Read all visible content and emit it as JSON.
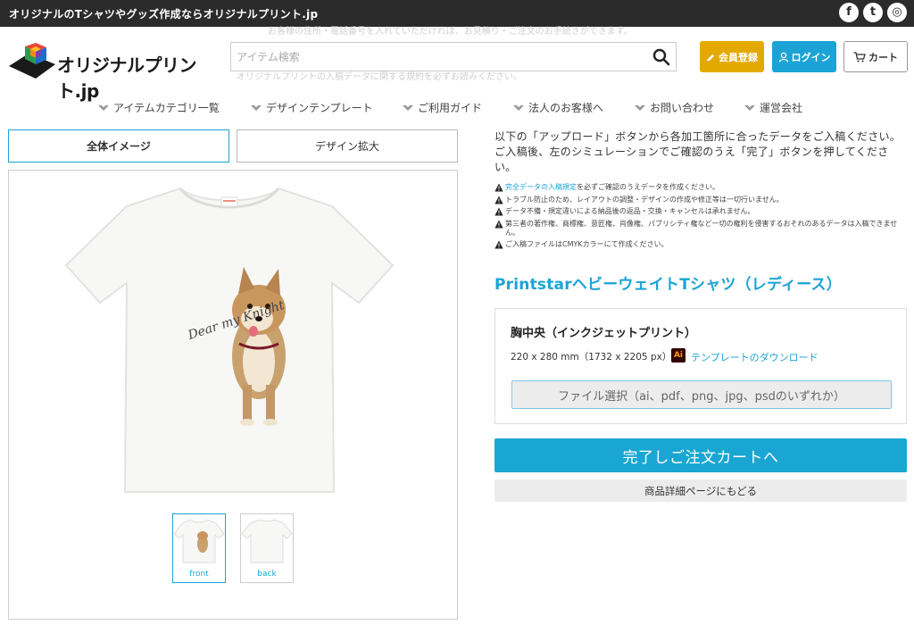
{
  "topbar": {
    "tagline": "オリジナルのTシャツやグッズ作成ならオリジナルプリント.jp",
    "social": [
      {
        "icon": "facebook-icon",
        "glyph": "f"
      },
      {
        "icon": "twitter-icon",
        "glyph": "t"
      },
      {
        "icon": "instagram-icon",
        "glyph": "◎"
      }
    ]
  },
  "header": {
    "logo_text": "オリジナルプリント.jp",
    "search_placeholder": "アイテム検索",
    "member_label": "会員登録",
    "login_label": "ログイン",
    "cart_label": "カート",
    "faded_text_1": "お客様の住所・電話番号を入れていただければ、お見積り・ご注文のお手続きができます。",
    "faded_text_2": "オリジナルプリントの入稿データに関する規約を必ずお読みください。"
  },
  "nav": {
    "items": [
      "アイテムカテゴリ一覧",
      "デザインテンプレート",
      "ご利用ガイド",
      "法人のお客様へ",
      "お問い合わせ",
      "運営会社"
    ]
  },
  "tabs": {
    "overall": "全体イメージ",
    "zoom": "デザイン拡大"
  },
  "thumbs": {
    "front": "front",
    "back": "back"
  },
  "design_text": "Dear my Knight",
  "intro": {
    "line1": "以下の「アップロード」ボタンから各加工箇所に合ったデータをご入稿ください。",
    "line2": "ご入稿後、左のシミュレーションでご確認のうえ「完了」ボタンを押してください。"
  },
  "notes": {
    "n1_link": "完全データの入稿規定",
    "n1_rest": "を必ずご確認のうえデータを作成ください。",
    "n2": "トラブル防止のため、レイアウトの調整・デザインの作成や修正等は一切行いません。",
    "n3": "データ不備・規定違いによる納品後の返品・交換・キャンセルは承れません。",
    "n4": "第三者の著作権、商標権、意匠権、肖像権、パブリシティ権など一切の権利を侵害するおそれのあるデータは入稿できません。",
    "n5": "ご入稿ファイルはCMYKカラーにて作成ください。"
  },
  "product": {
    "title": "PrintstarヘビーウェイトTシャツ（レディース）",
    "area_title": "胸中央（インクジェットプリント）",
    "dims": "220 x 280 mm（1732 x 2205 px）",
    "ai_badge": "Ai",
    "template_link": "テンプレートのダウンロード",
    "file_select": "ファイル選択（ai、pdf、png、jpg、psdのいずれか）"
  },
  "actions": {
    "complete": "完了しご注文カートへ",
    "back": "商品詳細ページにもどる"
  },
  "colors": {
    "accent": "#1ba3d6",
    "member": "#e4a900",
    "topbar": "#2b2b2b"
  }
}
